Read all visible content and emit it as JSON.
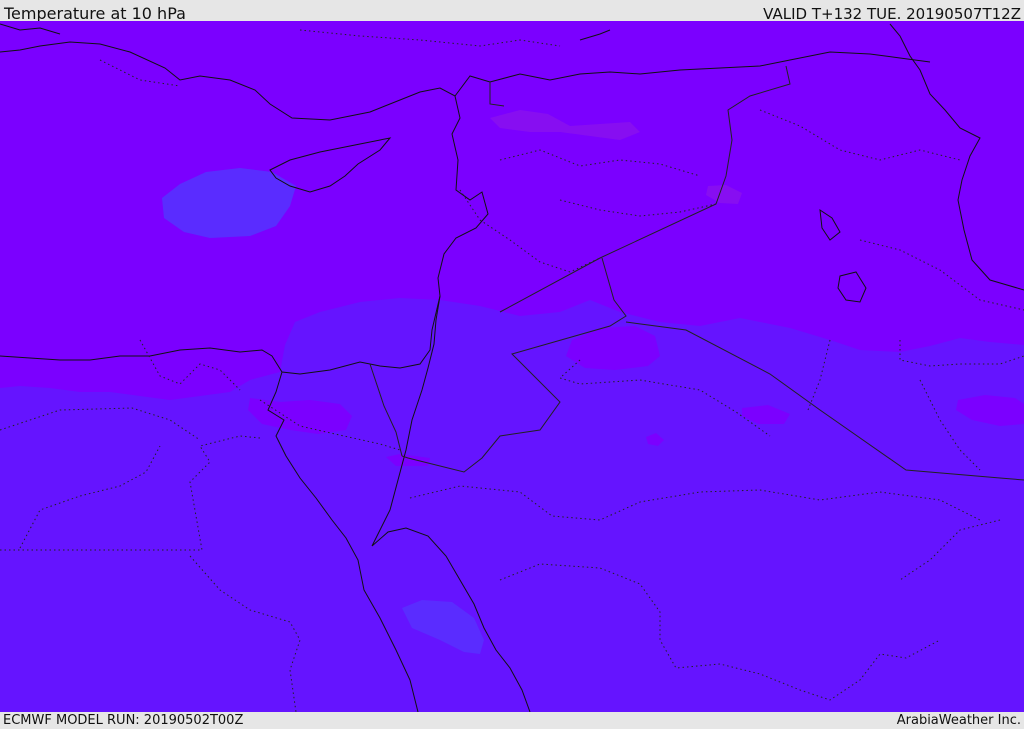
{
  "header": {
    "title": "Temperature at 10 hPa",
    "valid": "VALID T+132 TUE. 20190507T12Z"
  },
  "footer": {
    "model_run": "ECMWF MODEL RUN: 20190502T00Z",
    "credit": "ArabiaWeather Inc."
  },
  "colors": {
    "violet_band": "#7b00ff",
    "indigo_band": "#6514ff",
    "cool_patch": "#5a2cff",
    "warm_patch": "#8a10ee",
    "coastline": "#111111",
    "border": "#222222"
  },
  "map": {
    "parameter": "temperature",
    "level": "10 hPa",
    "region": "Middle East / Northeast Africa"
  }
}
